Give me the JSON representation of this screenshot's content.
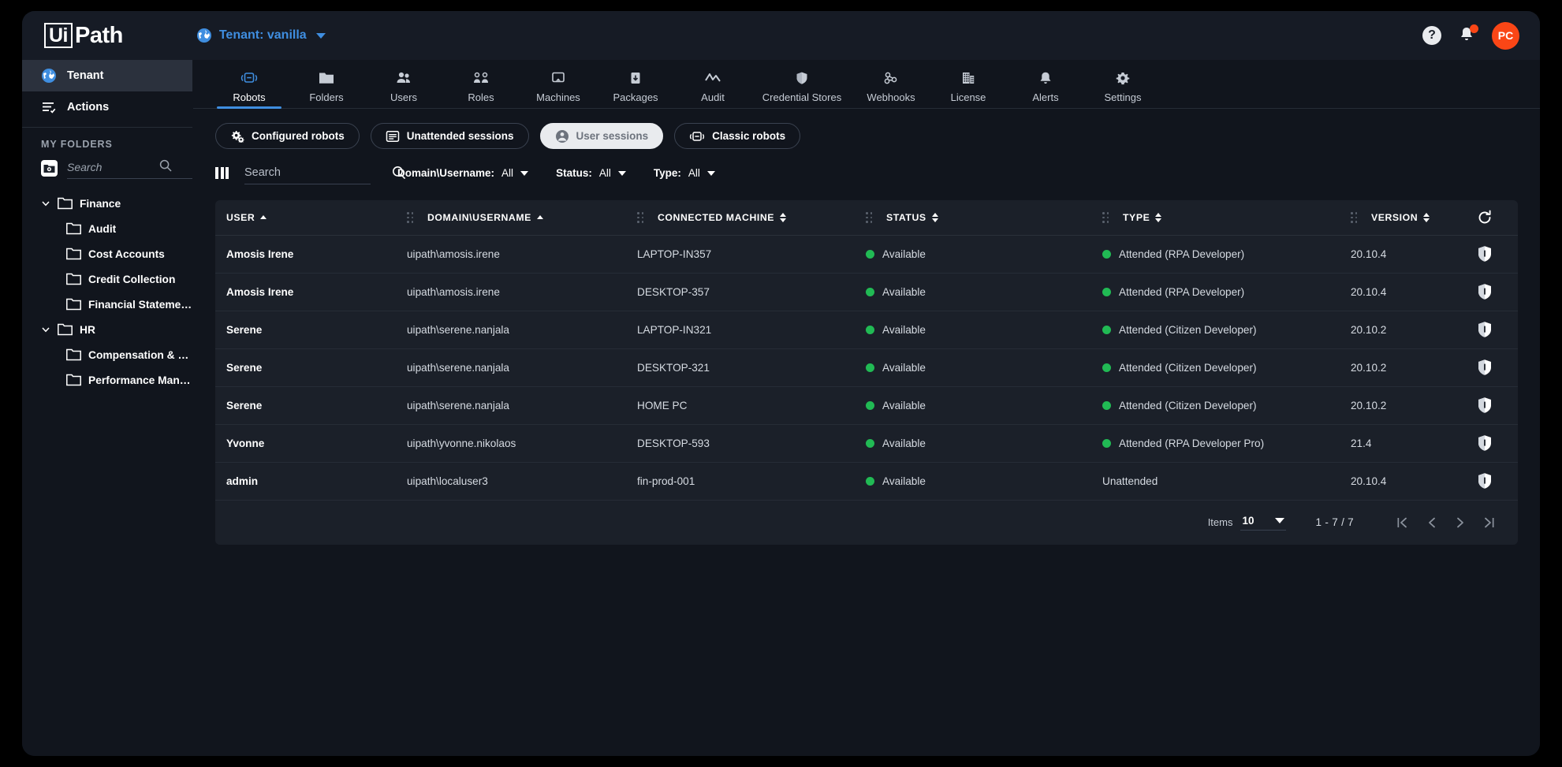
{
  "topbar": {
    "logo_ui": "Ui",
    "logo_path": "Path",
    "tenant_label": "Tenant: vanilla",
    "help_glyph": "?",
    "avatar_initials": "PC",
    "accent_blue": "#3f8ee0",
    "accent_orange": "#fa4616"
  },
  "sidebar": {
    "primary": [
      {
        "label": "Tenant",
        "icon": "globe-icon",
        "active": true
      },
      {
        "label": "Actions",
        "icon": "actions-icon",
        "active": false
      }
    ],
    "section_title": "MY FOLDERS",
    "search_placeholder": "Search",
    "search_value": "",
    "tree": [
      {
        "label": "Finance",
        "level": 1,
        "expanded": true
      },
      {
        "label": "Audit",
        "level": 2,
        "expanded": false
      },
      {
        "label": "Cost Accounts",
        "level": 2,
        "expanded": false
      },
      {
        "label": "Credit Collection",
        "level": 2,
        "expanded": false
      },
      {
        "label": "Financial Statements",
        "level": 2,
        "expanded": false
      },
      {
        "label": "HR",
        "level": 1,
        "expanded": true
      },
      {
        "label": "Compensation & Bene...",
        "level": 2,
        "expanded": false
      },
      {
        "label": "Performance Manage...",
        "level": 2,
        "expanded": false
      }
    ]
  },
  "tabs": [
    {
      "label": "Robots",
      "icon": "robot-icon",
      "active": true
    },
    {
      "label": "Folders",
      "icon": "folder-icon",
      "active": false
    },
    {
      "label": "Users",
      "icon": "users-icon",
      "active": false
    },
    {
      "label": "Roles",
      "icon": "roles-icon",
      "active": false
    },
    {
      "label": "Machines",
      "icon": "machine-icon",
      "active": false
    },
    {
      "label": "Packages",
      "icon": "package-icon",
      "active": false
    },
    {
      "label": "Audit",
      "icon": "audit-icon",
      "active": false
    },
    {
      "label": "Credential Stores",
      "icon": "shield-icon",
      "active": false
    },
    {
      "label": "Webhooks",
      "icon": "webhook-icon",
      "active": false
    },
    {
      "label": "License",
      "icon": "license-icon",
      "active": false
    },
    {
      "label": "Alerts",
      "icon": "bell-icon",
      "active": false
    },
    {
      "label": "Settings",
      "icon": "gear-icon",
      "active": false
    }
  ],
  "pills": [
    {
      "label": "Configured robots",
      "icon": "gears-icon",
      "active": false
    },
    {
      "label": "Unattended sessions",
      "icon": "list-icon",
      "active": false
    },
    {
      "label": "User sessions",
      "icon": "user-circle-icon",
      "active": true
    },
    {
      "label": "Classic robots",
      "icon": "classic-robot-icon",
      "active": false
    }
  ],
  "filters": {
    "search_placeholder": "Search",
    "search_value": "",
    "dropdowns": [
      {
        "label": "Domain\\Username:",
        "value": "All"
      },
      {
        "label": "Status:",
        "value": "All"
      },
      {
        "label": "Type:",
        "value": "All"
      }
    ]
  },
  "table": {
    "columns": [
      {
        "label": "USER",
        "sort": "asc",
        "grip": false
      },
      {
        "label": "DOMAIN\\USERNAME",
        "sort": "asc",
        "grip": true
      },
      {
        "label": "CONNECTED MACHINE",
        "sort": "both",
        "grip": true
      },
      {
        "label": "STATUS",
        "sort": "both",
        "grip": true
      },
      {
        "label": "TYPE",
        "sort": "both",
        "grip": true
      },
      {
        "label": "VERSION",
        "sort": "both",
        "grip": true
      }
    ],
    "refresh_icon": "refresh-icon",
    "rows": [
      {
        "user": "Amosis Irene",
        "domain": "uipath\\amosis.irene",
        "machine": "LAPTOP-IN357",
        "status": "Available",
        "status_dot": true,
        "type": "Attended (RPA Developer)",
        "type_dot": true,
        "version": "20.10.4",
        "action_icon": "shield-icon"
      },
      {
        "user": "Amosis Irene",
        "domain": "uipath\\amosis.irene",
        "machine": "DESKTOP-357",
        "status": "Available",
        "status_dot": true,
        "type": "Attended (RPA Developer)",
        "type_dot": true,
        "version": "20.10.4",
        "action_icon": "shield-icon"
      },
      {
        "user": "Serene",
        "domain": "uipath\\serene.nanjala",
        "machine": "LAPTOP-IN321",
        "status": "Available",
        "status_dot": true,
        "type": "Attended (Citizen Developer)",
        "type_dot": true,
        "version": "20.10.2",
        "action_icon": "shield-icon"
      },
      {
        "user": "Serene",
        "domain": "uipath\\serene.nanjala",
        "machine": "DESKTOP-321",
        "status": "Available",
        "status_dot": true,
        "type": "Attended (Citizen Developer)",
        "type_dot": true,
        "version": "20.10.2",
        "action_icon": "shield-icon"
      },
      {
        "user": "Serene",
        "domain": "uipath\\serene.nanjala",
        "machine": "HOME PC",
        "status": "Available",
        "status_dot": true,
        "type": "Attended (Citizen Developer)",
        "type_dot": true,
        "version": "20.10.2",
        "action_icon": "shield-icon"
      },
      {
        "user": "Yvonne",
        "domain": "uipath\\yvonne.nikolaos",
        "machine": "DESKTOP-593",
        "status": "Available",
        "status_dot": true,
        "type": "Attended (RPA Developer Pro)",
        "type_dot": true,
        "version": "21.4",
        "action_icon": "shield-icon"
      },
      {
        "user": "admin",
        "domain": "uipath\\localuser3",
        "machine": "fin-prod-001",
        "status": "Available",
        "status_dot": true,
        "type": "Unattended",
        "type_dot": false,
        "version": "20.10.4",
        "action_icon": "shield-icon"
      }
    ],
    "status_green": "#21ba54"
  },
  "pagination": {
    "items_label": "Items",
    "items_value": "10",
    "range": "1 - 7 / 7",
    "first_label": "|<",
    "prev_label": "<",
    "next_label": ">",
    "last_label": ">|"
  }
}
